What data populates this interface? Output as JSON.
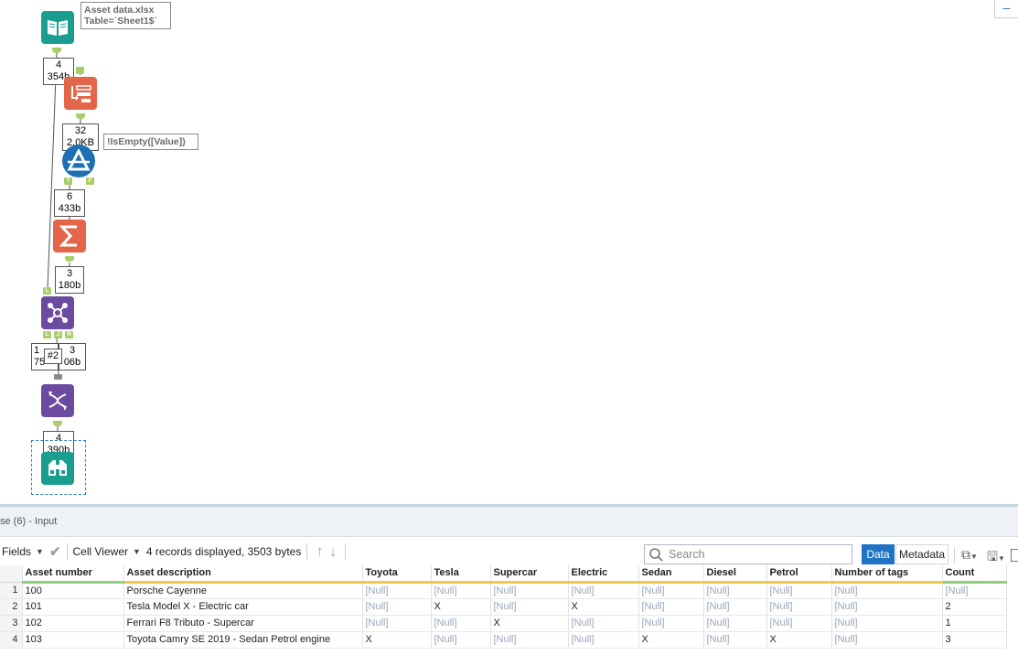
{
  "workflow": {
    "input_annotation": {
      "line1": "Asset data.xlsx",
      "line2": "Table=`Sheet1$`"
    },
    "filter_annotation": "!IsEmpty([Value])",
    "counts": {
      "input": {
        "records": "4",
        "size": "354b"
      },
      "transpose": {
        "records": "32",
        "size": "2.0KB"
      },
      "filter_true": {
        "records": "6",
        "size": "433b"
      },
      "summarize": {
        "records": "3",
        "size": "180b"
      },
      "join_left": {
        "records": "1",
        "size": "75"
      },
      "join_right": {
        "records": "3",
        "size": "06b"
      },
      "join_badge": "#2",
      "crosstab": {
        "records": "4",
        "size": "390b"
      }
    },
    "anchors": {
      "true": "T",
      "false": "F",
      "left": "L",
      "join": "J",
      "right": "R"
    },
    "colors": {
      "input": "#1a9e8f",
      "transpose": "#e4664a",
      "filter": "#1f6fb5",
      "summarize": "#e4664a",
      "join": "#6b4aa0",
      "crosstab": "#6b4aa0",
      "browse": "#1a9e8f",
      "anchor": "#a9cf6a"
    }
  },
  "results": {
    "title": "se (6) - Input",
    "toolbar": {
      "fields": "Fields",
      "cell_viewer": "Cell Viewer",
      "records_info": "4 records displayed, 3503 bytes",
      "search_placeholder": "Search",
      "data_btn": "Data",
      "metadata_btn": "Metadata"
    },
    "columns": [
      "Asset number",
      "Asset description",
      "Toyota",
      "Tesla",
      "Supercar",
      "Electric",
      "Sedan",
      "Diesel",
      "Petrol",
      "Number of tags",
      "Count"
    ],
    "rows": [
      {
        "n": "1",
        "cells": [
          "100",
          "Porsche Cayenne",
          "[Null]",
          "[Null]",
          "[Null]",
          "[Null]",
          "[Null]",
          "[Null]",
          "[Null]",
          "[Null]",
          "[Null]"
        ]
      },
      {
        "n": "2",
        "cells": [
          "101",
          "Tesla Model X - Electric car",
          "[Null]",
          "X",
          "[Null]",
          "X",
          "[Null]",
          "[Null]",
          "[Null]",
          "[Null]",
          "2"
        ]
      },
      {
        "n": "3",
        "cells": [
          "102",
          "Ferrari F8 Tributo - Supercar",
          "[Null]",
          "[Null]",
          "X",
          "[Null]",
          "[Null]",
          "[Null]",
          "[Null]",
          "[Null]",
          "1"
        ]
      },
      {
        "n": "4",
        "cells": [
          "103",
          "Toyota Camry SE 2019 - Sedan Petrol engine",
          "X",
          "[Null]",
          "[Null]",
          "[Null]",
          "X",
          "[Null]",
          "X",
          "[Null]",
          "3"
        ]
      }
    ]
  }
}
